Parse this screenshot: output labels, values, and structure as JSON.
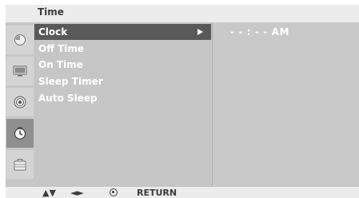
{
  "header": {
    "title": "Time"
  },
  "menu": {
    "items": [
      {
        "label": "Clock"
      },
      {
        "label": "Off Time"
      },
      {
        "label": "On Time"
      },
      {
        "label": "Sleep Timer"
      },
      {
        "label": "Auto Sleep"
      }
    ],
    "selected_index": 0
  },
  "value_panel": {
    "clock_value": "- - : - - AM"
  },
  "footer": {
    "updown_label": "▲▼",
    "leftright_label": "◄►",
    "return_label": "RETURN"
  },
  "sidebar": {
    "icons": [
      "picture-icon",
      "screen-icon",
      "sound-icon",
      "time-icon",
      "option-icon"
    ],
    "active_index": 3
  },
  "colors": {
    "highlight": "#59595b",
    "panel": "#c6c6c6",
    "text": "#ffffff"
  }
}
